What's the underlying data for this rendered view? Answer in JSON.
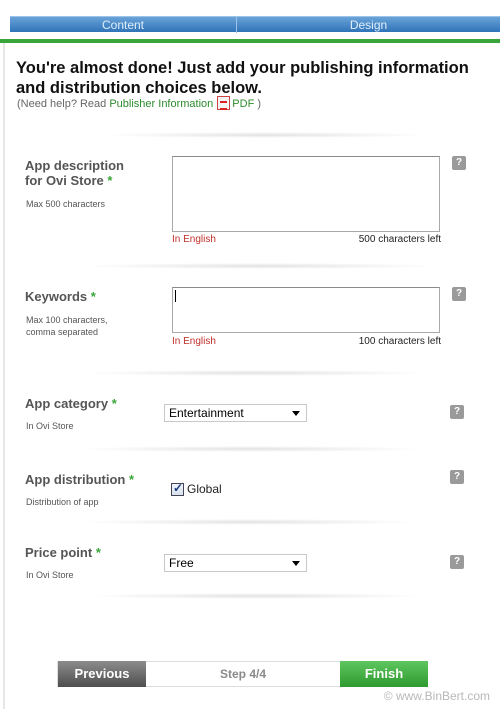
{
  "tabs": [
    "Content",
    "Design"
  ],
  "heading": "You're almost done! Just add your publishing information and distribution choices below.",
  "help": {
    "prefix": "(Need help? Read ",
    "link": "Publisher Information",
    "pdf_label": "PDF",
    "suffix": " )"
  },
  "fields": {
    "description": {
      "label_line1": "App description",
      "label_line2": "for Ovi Store",
      "required": "*",
      "hint": "Max 500 characters",
      "value": "",
      "lang": "In English",
      "chars_left": "500 characters left"
    },
    "keywords": {
      "label": "Keywords",
      "required": "*",
      "hint_line1": "Max 100 characters,",
      "hint_line2": "comma separated",
      "value": "",
      "lang": "In English",
      "chars_left": "100 characters left"
    },
    "category": {
      "label": "App category",
      "required": "*",
      "hint": "In Ovi Store",
      "selected": "Entertainment"
    },
    "distribution": {
      "label": "App distribution",
      "required": "*",
      "hint": "Distribution of app",
      "option_label": "Global",
      "checked": true
    },
    "price": {
      "label": "Price point",
      "required": "*",
      "hint": "In Ovi Store",
      "selected": "Free"
    }
  },
  "help_icon": "?",
  "footer": {
    "previous": "Previous",
    "step": "Step 4/4",
    "finish": "Finish"
  },
  "watermark": "© www.BinBert.com",
  "colors": {
    "accent_green": "#3aa53a",
    "tab_blue": "#2f73b8",
    "required_green": "#3aa53a",
    "lang_red": "#c0302a"
  }
}
